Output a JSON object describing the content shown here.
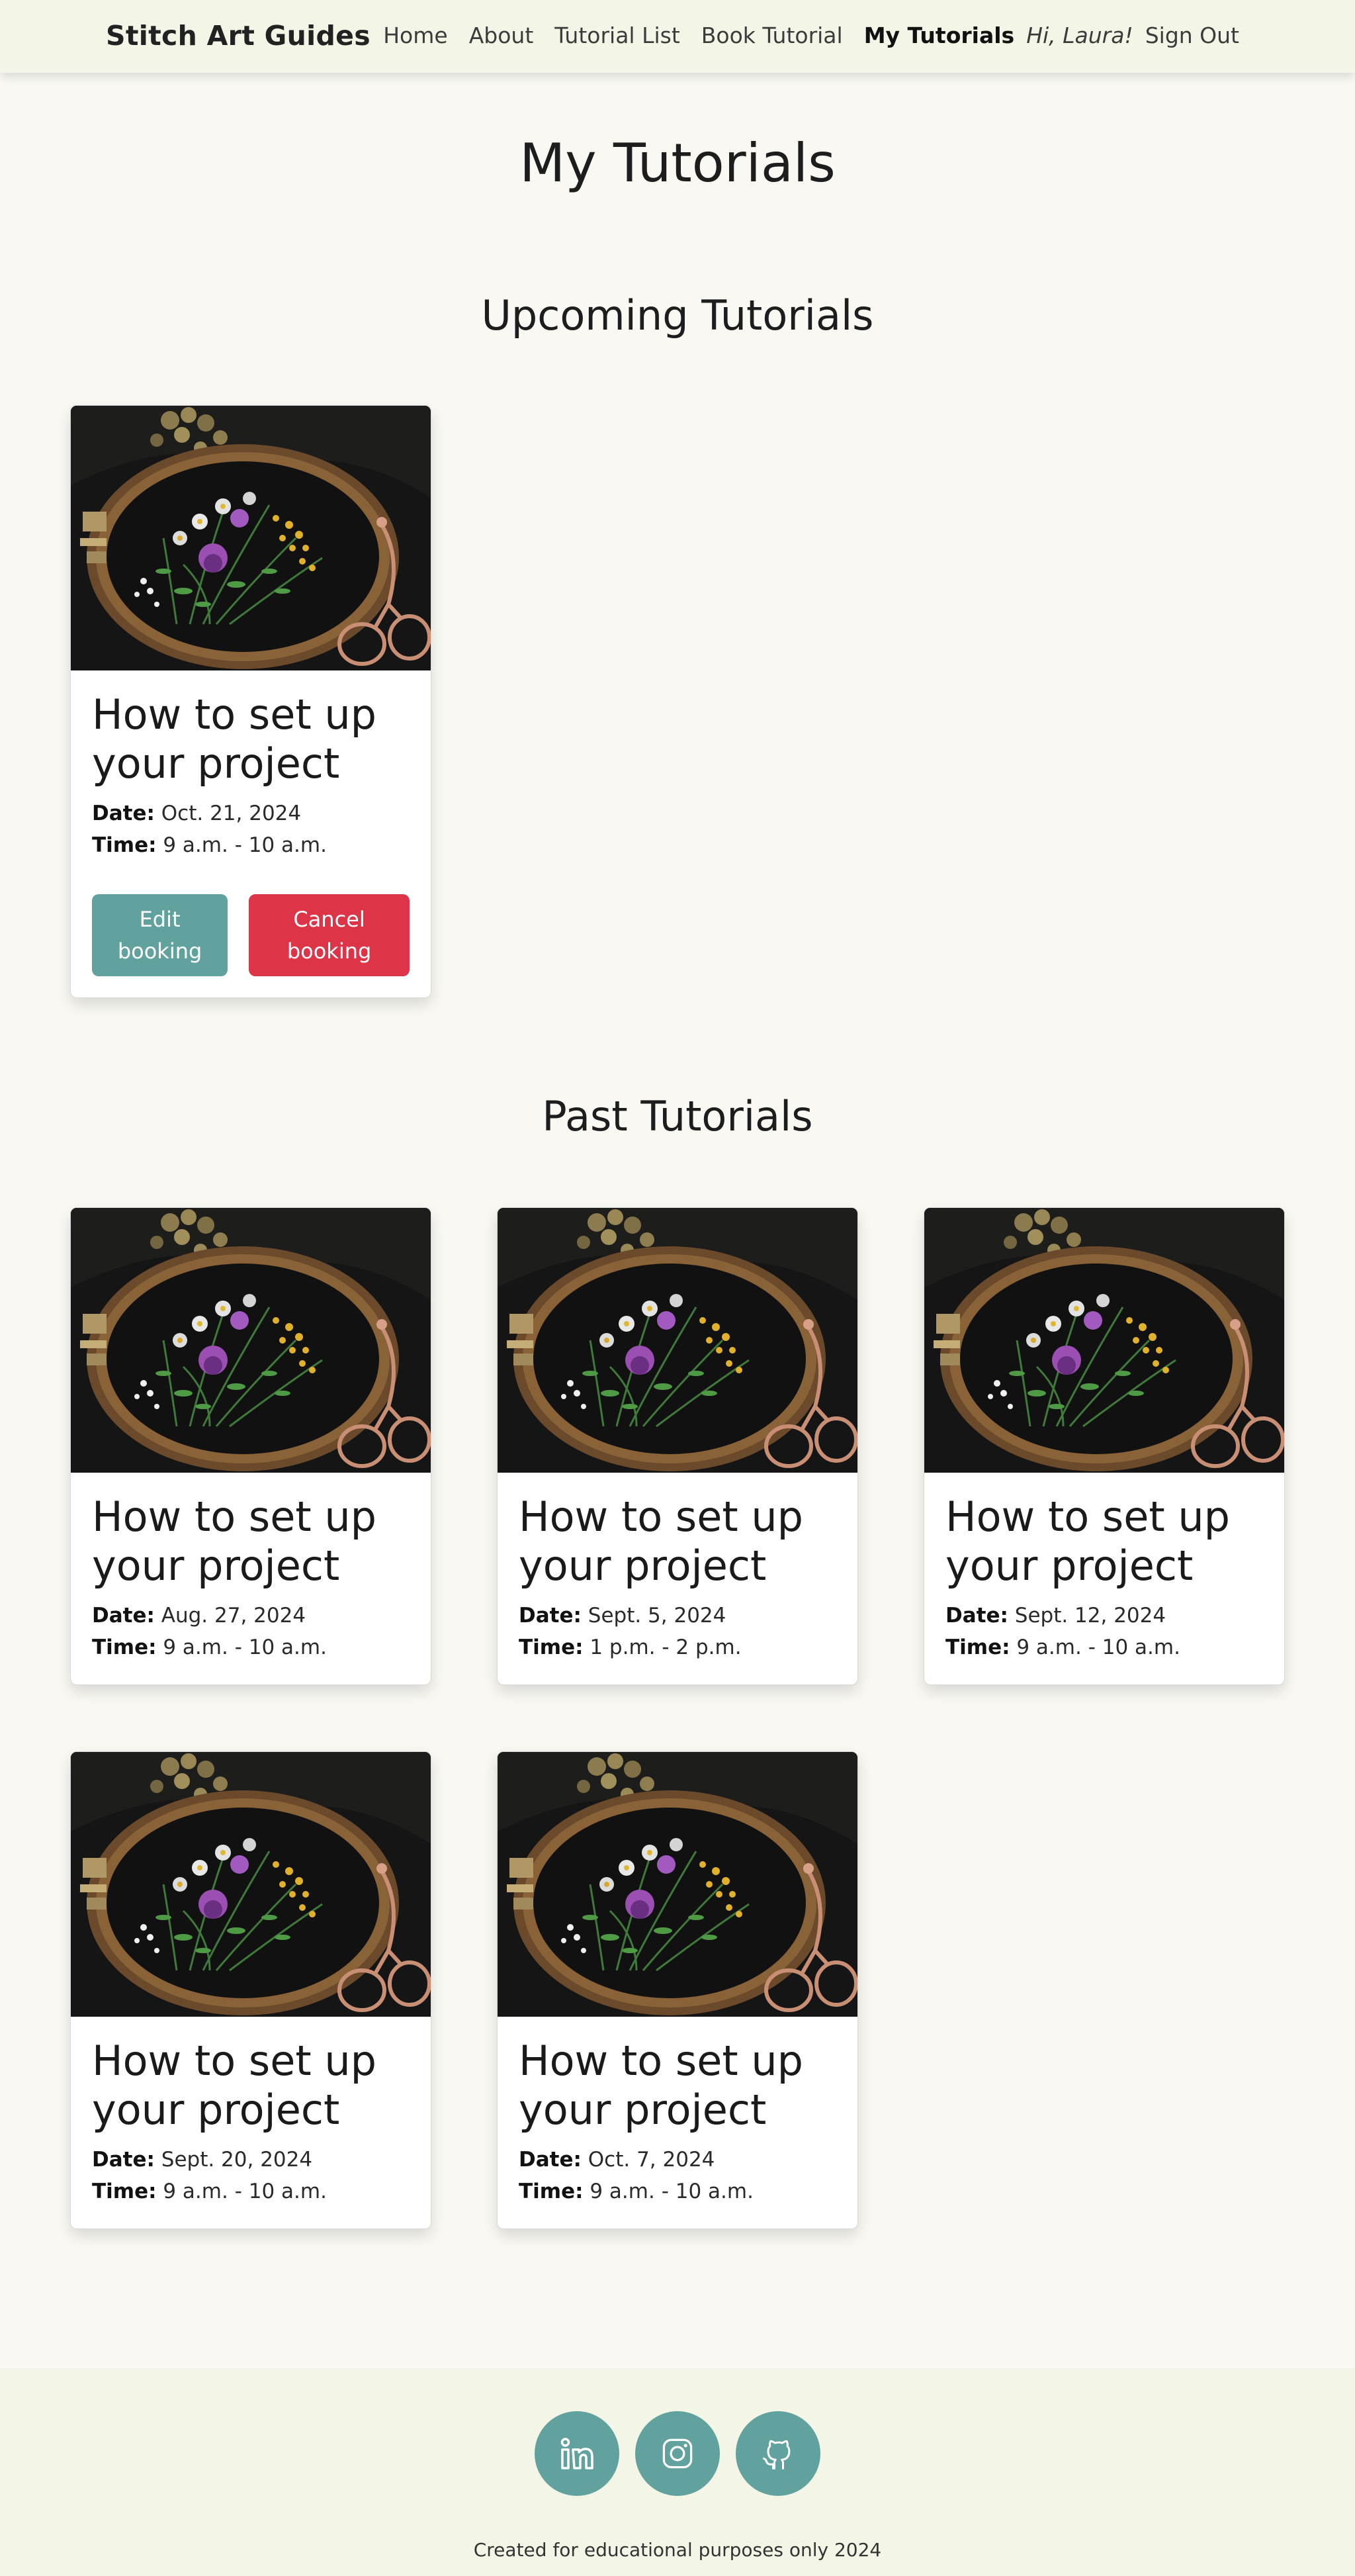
{
  "nav": {
    "brand": "Stitch Art Guides",
    "links": [
      {
        "label": "Home"
      },
      {
        "label": "About"
      },
      {
        "label": "Tutorial List"
      },
      {
        "label": "Book Tutorial"
      },
      {
        "label": "My Tutorials",
        "active": true
      }
    ],
    "greeting": "Hi, Laura!",
    "sign_out": "Sign Out"
  },
  "page_title": "My Tutorials",
  "upcoming": {
    "heading": "Upcoming Tutorials",
    "cards": [
      {
        "title": "How to set up your project",
        "date_label": "Date:",
        "date": "Oct. 21, 2024",
        "time_label": "Time:",
        "time": "9 a.m. - 10 a.m.",
        "edit_label": "Edit booking",
        "cancel_label": "Cancel booking"
      }
    ]
  },
  "past": {
    "heading": "Past Tutorials",
    "cards": [
      {
        "title": "How to set up your project",
        "date_label": "Date:",
        "date": "Aug. 27, 2024",
        "time_label": "Time:",
        "time": "9 a.m. - 10 a.m."
      },
      {
        "title": "How to set up your project",
        "date_label": "Date:",
        "date": "Sept. 5, 2024",
        "time_label": "Time:",
        "time": "1 p.m. - 2 p.m."
      },
      {
        "title": "How to set up your project",
        "date_label": "Date:",
        "date": "Sept. 12, 2024",
        "time_label": "Time:",
        "time": "9 a.m. - 10 a.m."
      },
      {
        "title": "How to set up your project",
        "date_label": "Date:",
        "date": "Sept. 20, 2024",
        "time_label": "Time:",
        "time": "9 a.m. - 10 a.m."
      },
      {
        "title": "How to set up your project",
        "date_label": "Date:",
        "date": "Oct. 7, 2024",
        "time_label": "Time:",
        "time": "9 a.m. - 10 a.m."
      }
    ]
  },
  "footer": {
    "socials": [
      {
        "icon": "linkedin-icon"
      },
      {
        "icon": "instagram-icon"
      },
      {
        "icon": "github-icon"
      }
    ],
    "text": "Created for educational purposes only 2024"
  },
  "colors": {
    "accent": "#62a29e",
    "danger": "#dd3447",
    "nav_bg": "#f3f6e6",
    "page_bg": "#f9f8f3"
  }
}
